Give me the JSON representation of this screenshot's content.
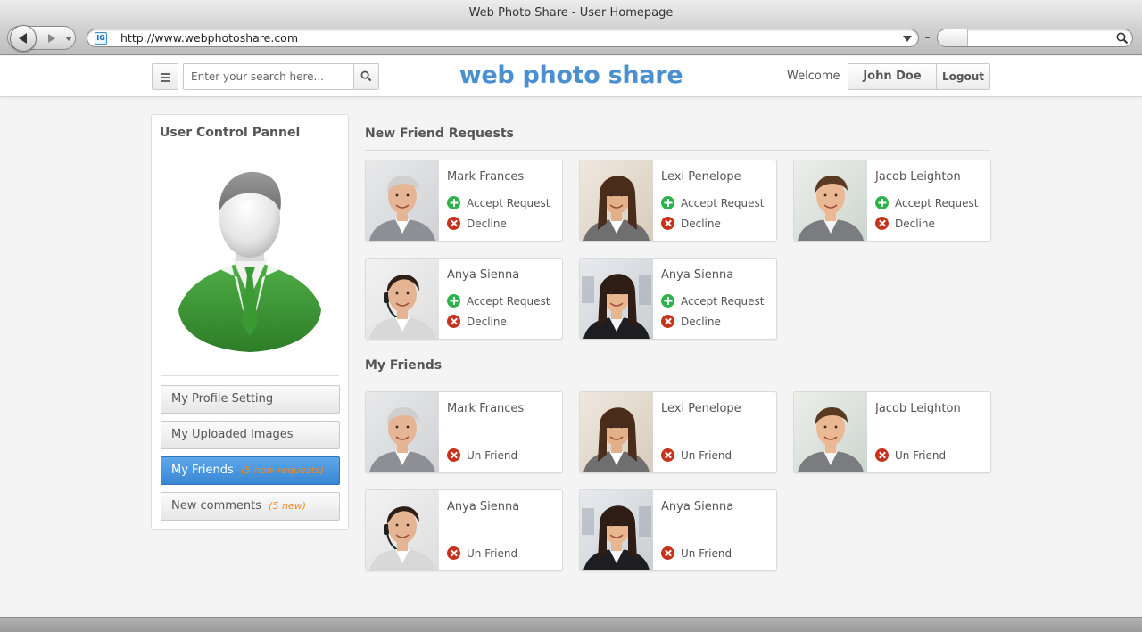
{
  "window": {
    "title": "Web Photo Share - User Homepage"
  },
  "browser": {
    "url": "http://www.webphotoshare.com",
    "site_icon_text": "IG",
    "search_value": ""
  },
  "header": {
    "search_placeholder": "Enter your search here...",
    "logo": "web photo share",
    "welcome": "Welcome",
    "user_name": "John Doe",
    "logout": "Logout"
  },
  "sidebar": {
    "title": "User Control Pannel",
    "items": [
      {
        "label": "My Profile Setting",
        "note": ""
      },
      {
        "label": "My Uploaded Images",
        "note": ""
      },
      {
        "label": "My Friends",
        "note": "(5 new requests)",
        "active": true
      },
      {
        "label": "New comments",
        "note": "(5 new)"
      }
    ]
  },
  "requests": {
    "title": "New Friend Requests",
    "accept_label": "Accept Request",
    "decline_label": "Decline",
    "people": [
      {
        "name": "Mark Frances",
        "photo": "older-man-portrait"
      },
      {
        "name": "Lexi Penelope",
        "photo": "woman-portrait"
      },
      {
        "name": "Jacob Leighton",
        "photo": "young-man-portrait"
      },
      {
        "name": "Anya Sienna",
        "photo": "headset-woman-portrait"
      },
      {
        "name": "Anya Sienna",
        "photo": "office-woman-portrait"
      }
    ]
  },
  "friends": {
    "title": "My Friends",
    "unfriend_label": "Un Friend",
    "people": [
      {
        "name": "Mark Frances",
        "photo": "older-man-portrait"
      },
      {
        "name": "Lexi Penelope",
        "photo": "woman-portrait"
      },
      {
        "name": "Jacob Leighton",
        "photo": "young-man-portrait"
      },
      {
        "name": "Anya Sienna",
        "photo": "headset-woman-portrait"
      },
      {
        "name": "Anya Sienna",
        "photo": "office-woman-portrait"
      }
    ]
  },
  "colors": {
    "accent": "#4a90d0",
    "active_button": "#3a86d2",
    "note": "#f08a1c",
    "accept": "#2bb34a",
    "decline": "#c6321c"
  }
}
